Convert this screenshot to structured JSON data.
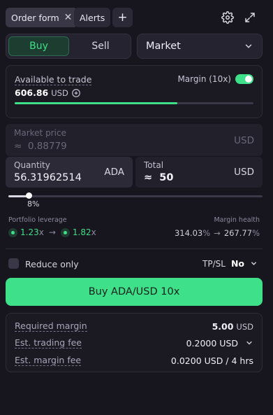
{
  "tabs": [
    {
      "label": "Order form",
      "active": true
    },
    {
      "label": "Alerts",
      "active": false
    }
  ],
  "side_toggle": {
    "buy": "Buy",
    "sell": "Sell",
    "selected": "Buy"
  },
  "order_type": "Market",
  "available": {
    "label": "Available to trade",
    "amount": "606.86",
    "currency": "USD",
    "margin_label": "Margin (10x)",
    "margin_enabled": true,
    "usage_fraction": 0.68
  },
  "market_price": {
    "label": "Market price",
    "prefix": "≈",
    "value": "0.88779",
    "unit": "USD"
  },
  "quantity": {
    "label": "Quantity",
    "value": "56.31962514",
    "unit": "ADA"
  },
  "total": {
    "label": "Total",
    "prefix": "≈",
    "value": "50",
    "unit": "USD"
  },
  "slider": {
    "percent_label": "8%",
    "value_percent": 8
  },
  "portfolio_leverage": {
    "label": "Portfolio leverage",
    "from": "1.23",
    "to": "1.82",
    "suffix": "x"
  },
  "margin_health": {
    "label": "Margin health",
    "from": "314.03",
    "to": "267.77",
    "suffix": "%"
  },
  "reduce_only": {
    "label": "Reduce only",
    "checked": false
  },
  "tpsl": {
    "label": "TP/SL",
    "value": "No"
  },
  "submit_label": "Buy ADA/USD 10x",
  "summary": {
    "required_margin": {
      "label": "Required margin",
      "value": "5.00",
      "unit": "USD"
    },
    "trading_fee": {
      "label": "Est. trading fee",
      "value": "0.2000 USD"
    },
    "margin_fee": {
      "label": "Est. margin fee",
      "value": "0.0200 USD / 4 hrs"
    }
  },
  "colors": {
    "accent": "#3ee089",
    "background": "#17151e",
    "panel": "#22202b"
  },
  "icons": [
    "close-icon",
    "plus-icon",
    "gear-icon",
    "expand-icon",
    "chevron-down-icon",
    "plus-circle-icon",
    "arrow-right-icon"
  ]
}
